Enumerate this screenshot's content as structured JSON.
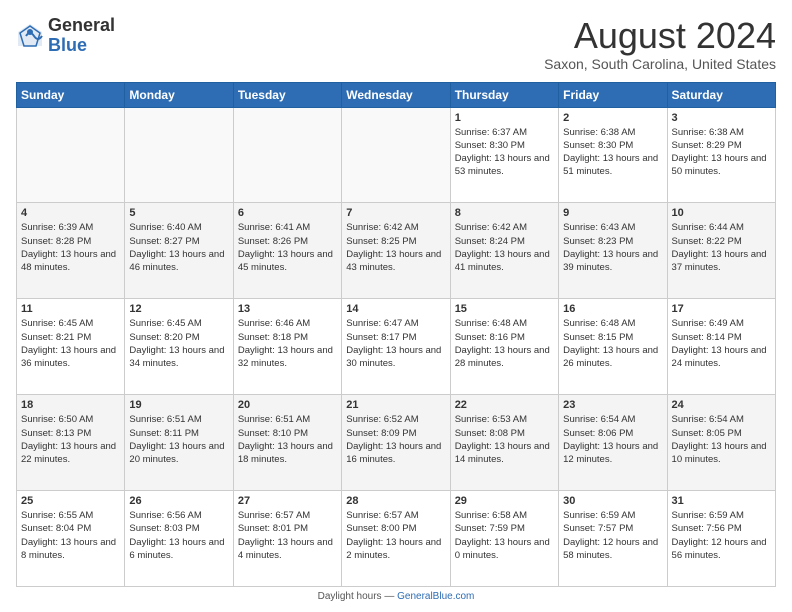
{
  "header": {
    "logo_general": "General",
    "logo_blue": "Blue",
    "month_title": "August 2024",
    "location": "Saxon, South Carolina, United States"
  },
  "calendar": {
    "days_of_week": [
      "Sunday",
      "Monday",
      "Tuesday",
      "Wednesday",
      "Thursday",
      "Friday",
      "Saturday"
    ],
    "weeks": [
      [
        {
          "day": "",
          "info": ""
        },
        {
          "day": "",
          "info": ""
        },
        {
          "day": "",
          "info": ""
        },
        {
          "day": "",
          "info": ""
        },
        {
          "day": "1",
          "info": "Sunrise: 6:37 AM\nSunset: 8:30 PM\nDaylight: 13 hours and 53 minutes."
        },
        {
          "day": "2",
          "info": "Sunrise: 6:38 AM\nSunset: 8:30 PM\nDaylight: 13 hours and 51 minutes."
        },
        {
          "day": "3",
          "info": "Sunrise: 6:38 AM\nSunset: 8:29 PM\nDaylight: 13 hours and 50 minutes."
        }
      ],
      [
        {
          "day": "4",
          "info": "Sunrise: 6:39 AM\nSunset: 8:28 PM\nDaylight: 13 hours and 48 minutes."
        },
        {
          "day": "5",
          "info": "Sunrise: 6:40 AM\nSunset: 8:27 PM\nDaylight: 13 hours and 46 minutes."
        },
        {
          "day": "6",
          "info": "Sunrise: 6:41 AM\nSunset: 8:26 PM\nDaylight: 13 hours and 45 minutes."
        },
        {
          "day": "7",
          "info": "Sunrise: 6:42 AM\nSunset: 8:25 PM\nDaylight: 13 hours and 43 minutes."
        },
        {
          "day": "8",
          "info": "Sunrise: 6:42 AM\nSunset: 8:24 PM\nDaylight: 13 hours and 41 minutes."
        },
        {
          "day": "9",
          "info": "Sunrise: 6:43 AM\nSunset: 8:23 PM\nDaylight: 13 hours and 39 minutes."
        },
        {
          "day": "10",
          "info": "Sunrise: 6:44 AM\nSunset: 8:22 PM\nDaylight: 13 hours and 37 minutes."
        }
      ],
      [
        {
          "day": "11",
          "info": "Sunrise: 6:45 AM\nSunset: 8:21 PM\nDaylight: 13 hours and 36 minutes."
        },
        {
          "day": "12",
          "info": "Sunrise: 6:45 AM\nSunset: 8:20 PM\nDaylight: 13 hours and 34 minutes."
        },
        {
          "day": "13",
          "info": "Sunrise: 6:46 AM\nSunset: 8:18 PM\nDaylight: 13 hours and 32 minutes."
        },
        {
          "day": "14",
          "info": "Sunrise: 6:47 AM\nSunset: 8:17 PM\nDaylight: 13 hours and 30 minutes."
        },
        {
          "day": "15",
          "info": "Sunrise: 6:48 AM\nSunset: 8:16 PM\nDaylight: 13 hours and 28 minutes."
        },
        {
          "day": "16",
          "info": "Sunrise: 6:48 AM\nSunset: 8:15 PM\nDaylight: 13 hours and 26 minutes."
        },
        {
          "day": "17",
          "info": "Sunrise: 6:49 AM\nSunset: 8:14 PM\nDaylight: 13 hours and 24 minutes."
        }
      ],
      [
        {
          "day": "18",
          "info": "Sunrise: 6:50 AM\nSunset: 8:13 PM\nDaylight: 13 hours and 22 minutes."
        },
        {
          "day": "19",
          "info": "Sunrise: 6:51 AM\nSunset: 8:11 PM\nDaylight: 13 hours and 20 minutes."
        },
        {
          "day": "20",
          "info": "Sunrise: 6:51 AM\nSunset: 8:10 PM\nDaylight: 13 hours and 18 minutes."
        },
        {
          "day": "21",
          "info": "Sunrise: 6:52 AM\nSunset: 8:09 PM\nDaylight: 13 hours and 16 minutes."
        },
        {
          "day": "22",
          "info": "Sunrise: 6:53 AM\nSunset: 8:08 PM\nDaylight: 13 hours and 14 minutes."
        },
        {
          "day": "23",
          "info": "Sunrise: 6:54 AM\nSunset: 8:06 PM\nDaylight: 13 hours and 12 minutes."
        },
        {
          "day": "24",
          "info": "Sunrise: 6:54 AM\nSunset: 8:05 PM\nDaylight: 13 hours and 10 minutes."
        }
      ],
      [
        {
          "day": "25",
          "info": "Sunrise: 6:55 AM\nSunset: 8:04 PM\nDaylight: 13 hours and 8 minutes."
        },
        {
          "day": "26",
          "info": "Sunrise: 6:56 AM\nSunset: 8:03 PM\nDaylight: 13 hours and 6 minutes."
        },
        {
          "day": "27",
          "info": "Sunrise: 6:57 AM\nSunset: 8:01 PM\nDaylight: 13 hours and 4 minutes."
        },
        {
          "day": "28",
          "info": "Sunrise: 6:57 AM\nSunset: 8:00 PM\nDaylight: 13 hours and 2 minutes."
        },
        {
          "day": "29",
          "info": "Sunrise: 6:58 AM\nSunset: 7:59 PM\nDaylight: 13 hours and 0 minutes."
        },
        {
          "day": "30",
          "info": "Sunrise: 6:59 AM\nSunset: 7:57 PM\nDaylight: 12 hours and 58 minutes."
        },
        {
          "day": "31",
          "info": "Sunrise: 6:59 AM\nSunset: 7:56 PM\nDaylight: 12 hours and 56 minutes."
        }
      ]
    ]
  },
  "footer": {
    "note": "Daylight hours"
  }
}
